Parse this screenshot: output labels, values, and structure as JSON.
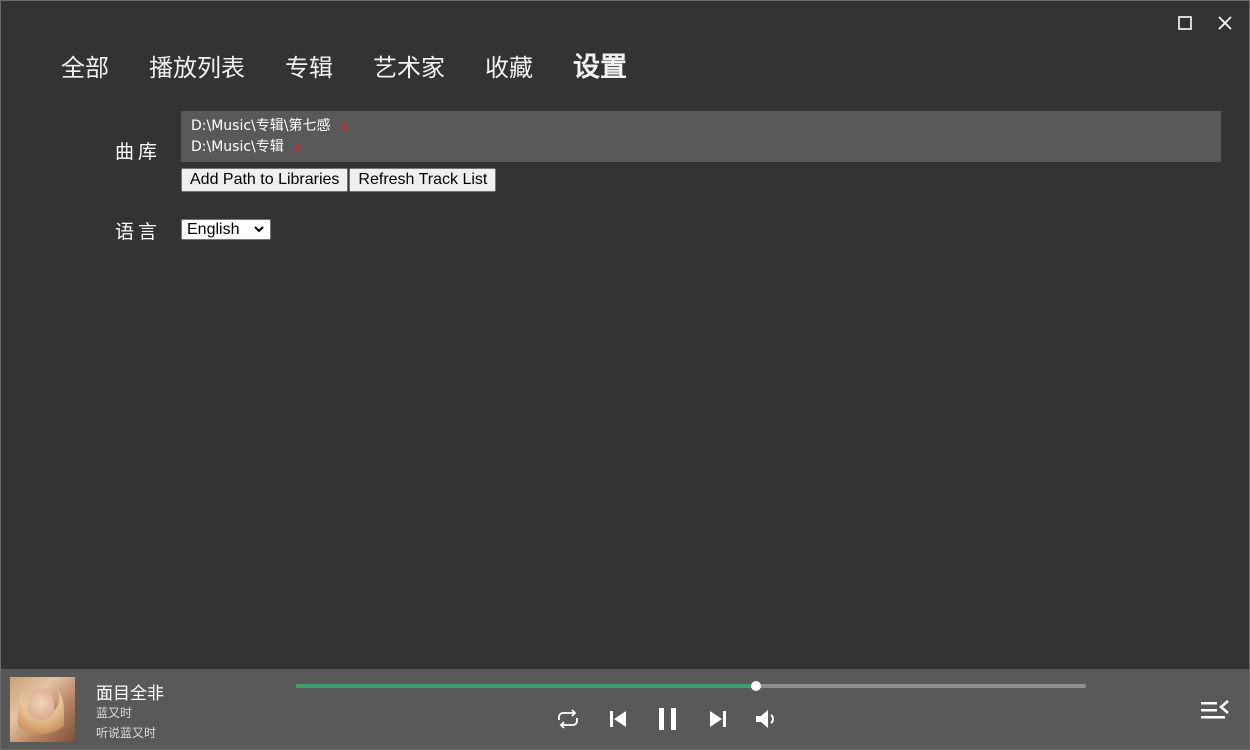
{
  "window": {
    "maximize_icon": "maximize-icon",
    "close_icon": "close-icon"
  },
  "nav": {
    "tabs": [
      {
        "label": "全部",
        "active": false
      },
      {
        "label": "播放列表",
        "active": false
      },
      {
        "label": "专辑",
        "active": false
      },
      {
        "label": "艺术家",
        "active": false
      },
      {
        "label": "收藏",
        "active": false
      },
      {
        "label": "设置",
        "active": true
      }
    ]
  },
  "settings": {
    "library_label": "曲库",
    "library_paths": [
      {
        "path": "D:\\Music\\专辑\\第七感",
        "remove": "x"
      },
      {
        "path": "D:\\Music\\专辑",
        "remove": "x"
      }
    ],
    "add_path_button": "Add Path to Libraries",
    "refresh_button": "Refresh Track List",
    "language_label": "语言",
    "language_value": "English"
  },
  "player": {
    "title": "面目全非",
    "album": "蓝又时",
    "artist": "听说蓝又时",
    "progress": 0.582,
    "colors": {
      "progress_fill": "#3d9e6b",
      "progress_track": "#8e8e8e",
      "bar_bg": "#595959",
      "app_bg": "#333333"
    },
    "icons": [
      "repeat-icon",
      "previous-icon",
      "pause-icon",
      "next-icon",
      "volume-icon",
      "queue-icon"
    ]
  }
}
